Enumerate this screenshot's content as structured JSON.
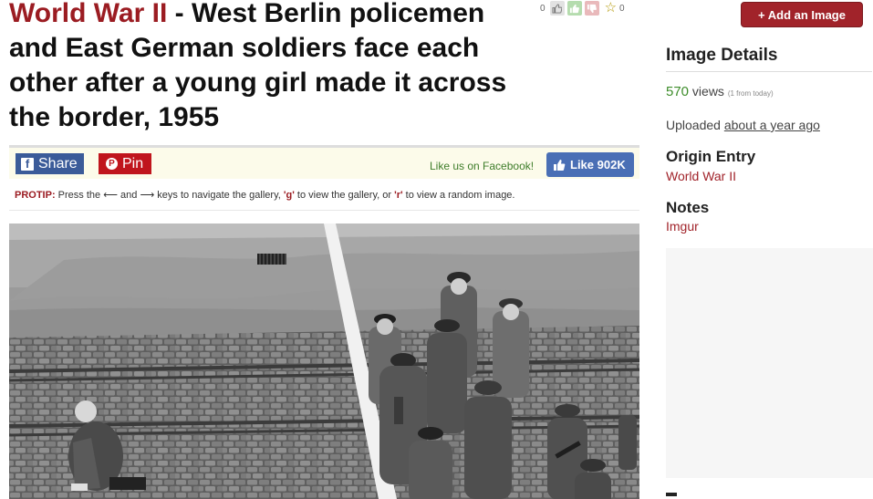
{
  "title": {
    "category": "World War II",
    "separator": " - ",
    "text": "West Berlin policemen and East German soldiers face each other after a young girl made it across the border, 1955"
  },
  "votes": {
    "up_count": "0",
    "star_count": "0"
  },
  "share": {
    "facebook_label": "Share",
    "pinterest_label": "Pin",
    "like_prompt": "Like us on Facebook!",
    "like_label": "Like 902K"
  },
  "protip": {
    "label": "PROTIP:",
    "text_before": " Press the ",
    "left_arrow": "⟵",
    "and": " and ",
    "right_arrow": "⟶",
    "text_mid": " keys to navigate the gallery, ",
    "g_key": "'g'",
    "text_mid2": " to view the gallery, or ",
    "r_key": "'r'",
    "text_end": " to view a random image."
  },
  "sidebar": {
    "add_button": "+ Add an Image",
    "details_heading": "Image Details",
    "views_count": "570",
    "views_word": " views",
    "views_note": "(1 from today)",
    "uploaded_prefix": "Uploaded ",
    "uploaded_when": "about a year ago",
    "origin_heading": "Origin Entry",
    "origin_link": "World War II",
    "notes_heading": "Notes",
    "notes_link": "Imgur"
  },
  "colors": {
    "brand": "#9b1c22",
    "facebook": "#3b5b99",
    "pinterest": "#c0151d",
    "views": "#3e8d2b"
  }
}
